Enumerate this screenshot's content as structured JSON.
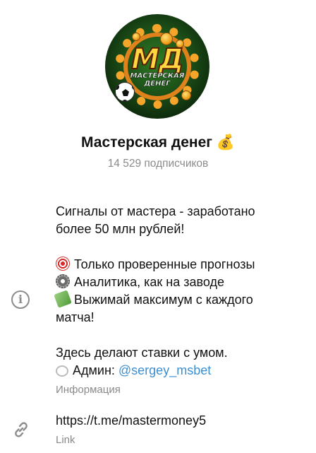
{
  "channel": {
    "avatar": {
      "logo_text": "МД",
      "logo_subtitle_line1": "МАСТЕРСКАЯ",
      "logo_subtitle_line2": "ДЕНЕГ",
      "colors": {
        "background": "#1b4d17",
        "gear": "#f4a52a",
        "logo": "#ffd640"
      }
    },
    "title": "Мастерская денег 💰",
    "subscribers": "14 529 подписчиков"
  },
  "info_section": {
    "icon": "info-icon",
    "description": {
      "line1": "Сигналы от мастера - заработано",
      "line2": "более 50 млн рублей!",
      "bullet1": "Только проверенные прогнозы",
      "bullet1_icon": "target-icon",
      "bullet2": "Аналитика, как на заводе",
      "bullet2_icon": "gear-icon",
      "bullet3_line1": "Выжимай максимум с каждого",
      "bullet3_line2": "матча!",
      "bullet3_icon": "money-icon",
      "line_bets": "Здесь делают ставки с умом.",
      "admin_label": "Админ: ",
      "admin_icon": "speech-bubble-icon",
      "admin_handle": "@sergey_msbet"
    },
    "label": "Информация"
  },
  "link_section": {
    "icon": "link-icon",
    "url": "https://t.me/mastermoney5",
    "label": "Link"
  },
  "colors": {
    "accent": "#3d8fd1",
    "secondary_text": "#8a8a8a"
  }
}
